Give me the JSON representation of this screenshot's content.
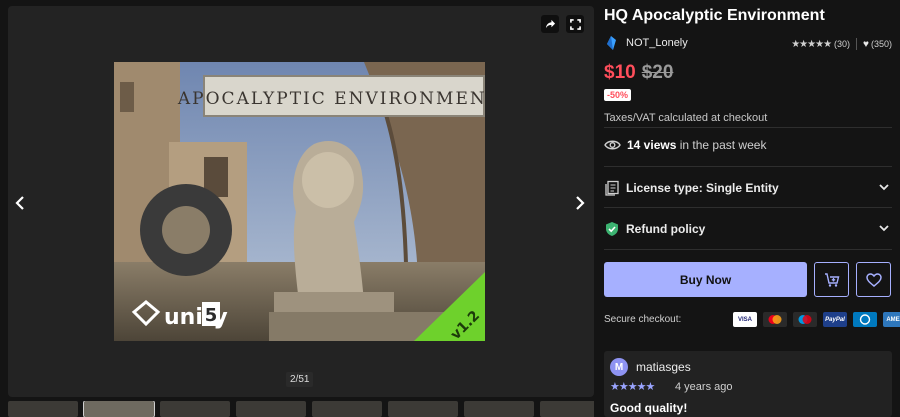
{
  "gallery": {
    "counter": "2/51",
    "hero_sign_text": "APOCALYPTIC ENVIRONMENT",
    "hero_unity_text": "unity",
    "hero_unity_version": "5",
    "hero_version_badge": "v1.2",
    "thumbnail_count": 8,
    "active_thumbnail_index": 1
  },
  "product": {
    "title": "HQ Apocalyptic Environment",
    "publisher": "NOT_Lonely",
    "rating_stars": "★★★★★",
    "rating_count": "(30)",
    "favorites_count": "(350)",
    "price_now": "$10",
    "price_old": "$20",
    "discount": "-50%",
    "vat_note": "Taxes/VAT calculated at checkout"
  },
  "views": {
    "count": "14 views",
    "suffix": "in the past week"
  },
  "license": {
    "label": "License type: Single Entity"
  },
  "refund": {
    "label": "Refund policy"
  },
  "actions": {
    "buy_now": "Buy Now"
  },
  "checkout": {
    "label": "Secure checkout:",
    "cards": [
      {
        "name": "VISA",
        "bg": "#ffffff",
        "fg": "#1a1f71"
      },
      {
        "name": "MC",
        "bg": "#2a2a2a",
        "fg": "#ff5f00"
      },
      {
        "name": "Maestro",
        "bg": "#2a2a2a",
        "fg": "#0099df"
      },
      {
        "name": "PayPal",
        "bg": "#1e3f8a",
        "fg": "#ffffff"
      },
      {
        "name": "Diners",
        "bg": "#0079be",
        "fg": "#ffffff"
      },
      {
        "name": "AMEX",
        "bg": "#2e77bc",
        "fg": "#ffffff"
      }
    ]
  },
  "review": {
    "avatar_initial": "M",
    "reviewer": "matiasges",
    "stars": "★★★★★",
    "time": "4 years ago",
    "title": "Good quality!"
  },
  "colors": {
    "accent": "#a6b0ff",
    "sale_red": "#ff4e5b",
    "background": "#141414"
  }
}
